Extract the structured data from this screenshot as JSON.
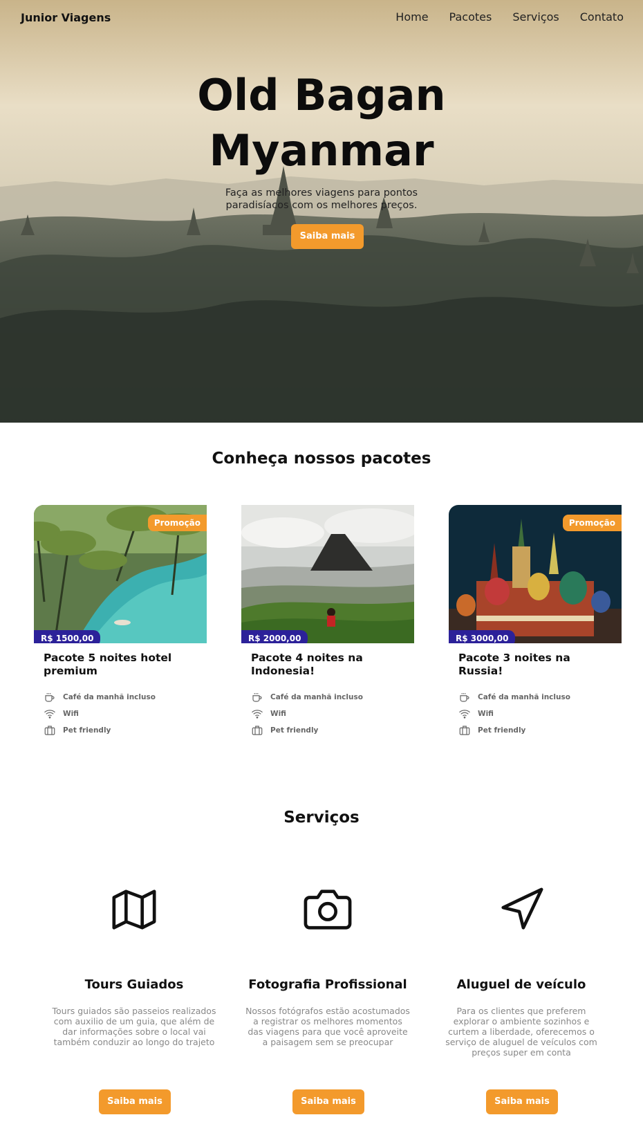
{
  "nav": {
    "brand": "Junior Viagens",
    "links": [
      "Home",
      "Pacotes",
      "Serviços",
      "Contato"
    ]
  },
  "hero": {
    "title_line1": "Old Bagan",
    "title_line2": "Myanmar",
    "subtitle": "Faça as melhores viagens para pontos paradisíacos com os melhores preços.",
    "button": "Saiba mais"
  },
  "packages": {
    "title": "Conheça nossos pacotes",
    "cards": [
      {
        "promo": "Promoção",
        "price": "R$ 1500,00",
        "title": "Pacote 5 noites hotel premium",
        "features": [
          "Café da manhã incluso",
          "Wifi",
          "Pet friendly"
        ]
      },
      {
        "promo": "",
        "price": "R$ 2000,00",
        "title": "Pacote 4 noites na Indonesia!",
        "features": [
          "Café da manhã incluso",
          "Wifi",
          "Pet friendly"
        ]
      },
      {
        "promo": "Promoção",
        "price": "R$ 3000,00",
        "title": "Pacote 3 noites na Russia!",
        "features": [
          "Café da manhã incluso",
          "Wifi",
          "Pet friendly"
        ]
      }
    ]
  },
  "services": {
    "title": "Serviços",
    "items": [
      {
        "icon": "map-icon",
        "title": "Tours Guiados",
        "text": "Tours guiados são passeios realizados com auxilio de um guia, que além de dar informações sobre o local vai também conduzir ao longo do trajeto",
        "button": "Saiba mais"
      },
      {
        "icon": "camera-icon",
        "title": "Fotografia Profissional",
        "text": "Nossos fotógrafos estão acostumados a registrar os melhores momentos das viagens para que você aproveite a paisagem sem se preocupar",
        "button": "Saiba mais"
      },
      {
        "icon": "navigation-icon",
        "title": "Aluguel de veículo",
        "text": "Para os clientes que preferem explorar o ambiente sozinhos e curtem a liberdade, oferecemos o serviço de aluguel de veículos com preços super em conta",
        "button": "Saiba mais"
      }
    ]
  },
  "colors": {
    "accent": "#f39a2c",
    "price_badge": "#2c2199"
  }
}
